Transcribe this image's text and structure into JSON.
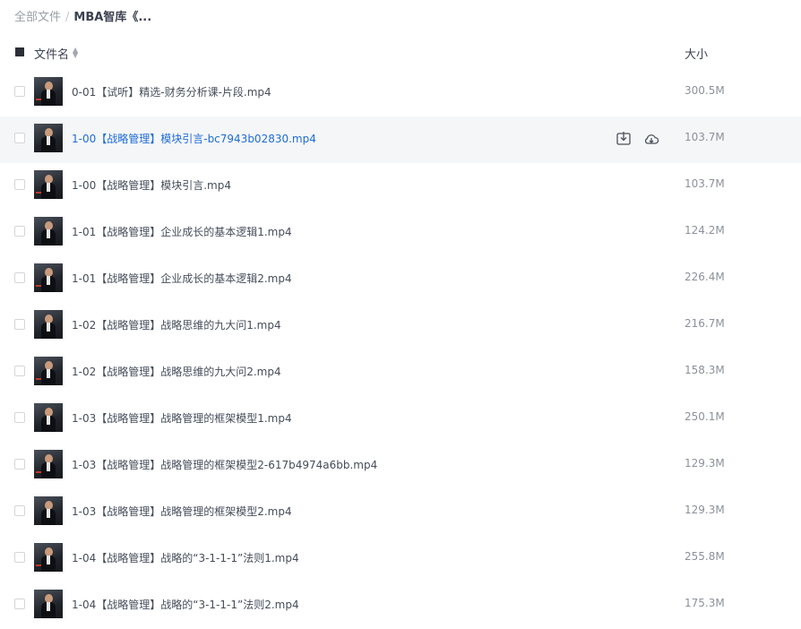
{
  "breadcrumb": {
    "root": "全部文件",
    "separator": "/",
    "current": "MBA智库《..."
  },
  "header": {
    "name_label": "文件名",
    "size_label": "大小"
  },
  "accent_color": "#1e6cd6",
  "hover_row_index": 1,
  "files": [
    {
      "name": "0-01【试听】精选-财务分析课-片段.mp4",
      "size": "300.5M"
    },
    {
      "name": "1-00【战略管理】模块引言-bc7943b02830.mp4",
      "size": "103.7M"
    },
    {
      "name": "1-00【战略管理】模块引言.mp4",
      "size": "103.7M"
    },
    {
      "name": "1-01【战略管理】企业成长的基本逻辑1.mp4",
      "size": "124.2M"
    },
    {
      "name": "1-01【战略管理】企业成长的基本逻辑2.mp4",
      "size": "226.4M"
    },
    {
      "name": "1-02【战略管理】战略思维的九大问1.mp4",
      "size": "216.7M"
    },
    {
      "name": "1-02【战略管理】战略思维的九大问2.mp4",
      "size": "158.3M"
    },
    {
      "name": "1-03【战略管理】战略管理的框架模型1.mp4",
      "size": "250.1M"
    },
    {
      "name": "1-03【战略管理】战略管理的框架模型2-617b4974a6bb.mp4",
      "size": "129.3M"
    },
    {
      "name": "1-03【战略管理】战略管理的框架模型2.mp4",
      "size": "129.3M"
    },
    {
      "name": "1-04【战略管理】战略的“3-1-1-1”法则1.mp4",
      "size": "255.8M"
    },
    {
      "name": "1-04【战略管理】战略的“3-1-1-1”法则2.mp4",
      "size": "175.3M"
    }
  ]
}
